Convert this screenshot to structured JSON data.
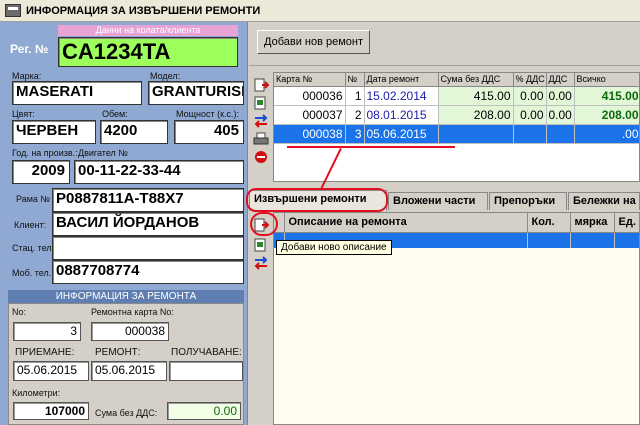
{
  "window": {
    "title": "ИНФОРМАЦИЯ ЗА ИЗВЪРШЕНИ РЕМОНТИ"
  },
  "vehicle": {
    "section_title": "Данни на колата/клиента",
    "reg_label": "Рег. №",
    "reg_value": "CA1234TA",
    "make_label": "Марка:",
    "make_value": "MASERATI",
    "model_label": "Модел:",
    "model_value": "GRANTURISMO",
    "color_label": "Цвят:",
    "color_value": "ЧЕРВЕН",
    "volume_label": "Обем:",
    "volume_value": "4200",
    "power_label": "Мощност (к.с.):",
    "power_value": "405",
    "year_label": "Год. на произв.:",
    "year_value": "2009",
    "engine_label": "Двигател №",
    "engine_value": "00-11-22-33-44",
    "frame_label": "Рама №",
    "frame_value": "P0887811A-T88X7",
    "client_label": "Клиент:",
    "client_value": "ВАСИЛ ЙОРДАНОВ",
    "phone_label": "Стац. тел.:",
    "phone_value": "",
    "mobile_label": "Моб. тел.:",
    "mobile_value": "0887708774"
  },
  "repair_info": {
    "title": "ИНФОРМАЦИЯ ЗА РЕМОНТА",
    "no_label": "No:",
    "no_value": "3",
    "card_label": "Ремонтна карта No:",
    "card_value": "000038",
    "accept_label": "ПРИЕМАНЕ:",
    "accept_value": "05.06.2015",
    "repair_label": "РЕМОНТ:",
    "repair_value": "05.06.2015",
    "receive_label": "ПОЛУЧАВАНЕ:",
    "receive_value": "",
    "km_label": "Километри:",
    "km_value": "107000",
    "sum_label": "Сума без ДДС:",
    "sum_value": "0.00"
  },
  "toolbar": {
    "add_repair": "Добави нов ремонт"
  },
  "repairs_table": {
    "columns": [
      "Карта №",
      "№",
      "Дата ремонт",
      "Сума без ДДС",
      "% ДДС",
      "ДДС",
      "Всичко"
    ],
    "rows": [
      {
        "card": "000036",
        "n": "1",
        "date": "15.02.2014",
        "sum": "415.00",
        "vat_pct": "0.00",
        "vat": "0.00",
        "total": "415.00"
      },
      {
        "card": "000037",
        "n": "2",
        "date": "08.01.2015",
        "sum": "208.00",
        "vat_pct": "0.00",
        "vat": "0.00",
        "total": "208.00"
      },
      {
        "card": "000038",
        "n": "3",
        "date": "05.06.2015",
        "sum": "",
        "vat_pct": "",
        "vat": "",
        "total": ".00"
      }
    ]
  },
  "tabs": [
    {
      "label": "Извършени ремонти"
    },
    {
      "label": "Вложени части"
    },
    {
      "label": "Препоръки"
    },
    {
      "label": "Бележки на"
    }
  ],
  "detail_table": {
    "columns": [
      "Описание на ремонта",
      "Кол.",
      "мярка",
      "Ед."
    ]
  },
  "tooltip": "Добави ново описание",
  "colors": {
    "accent": "#e01020",
    "selection": "#1a73e8",
    "panel": "#8fa9d3",
    "reg_bg": "#9dff5c"
  }
}
